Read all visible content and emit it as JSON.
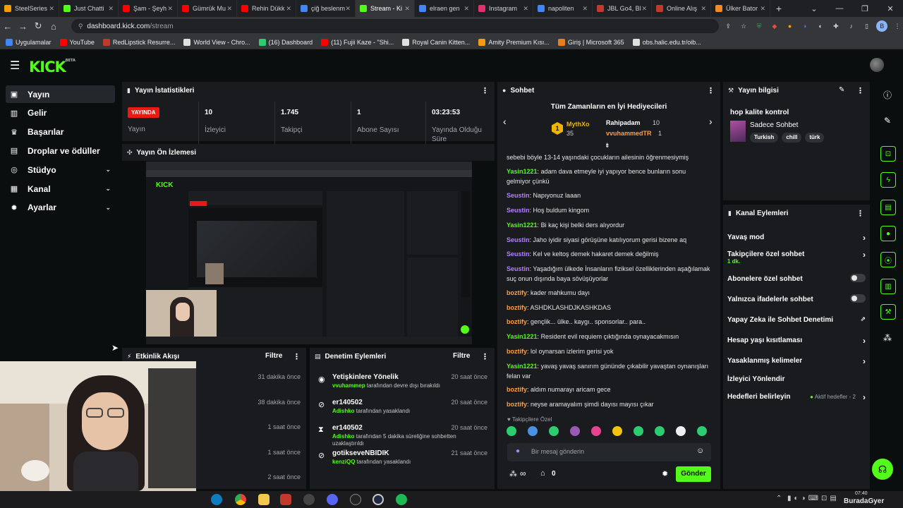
{
  "browser": {
    "tabs": [
      {
        "label": "SteelSeries",
        "color": "#f29f05"
      },
      {
        "label": "Just Chatti",
        "color": "#53fc18"
      },
      {
        "label": "Şam - Şeyh",
        "color": "#ff0000"
      },
      {
        "label": "Gümrük Mu",
        "color": "#ff0000"
      },
      {
        "label": "Rehin Dükk",
        "color": "#ff0000"
      },
      {
        "label": "çiğ beslenm",
        "color": "#4285f4"
      },
      {
        "label": "Stream - Ki",
        "color": "#53fc18",
        "active": true
      },
      {
        "label": "elraen gen",
        "color": "#4285f4"
      },
      {
        "label": "Instagram",
        "color": "#e1306c"
      },
      {
        "label": "napoliten",
        "color": "#4285f4"
      },
      {
        "label": "JBL Go4, Bl",
        "color": "#c0392b"
      },
      {
        "label": "Online Alış",
        "color": "#c0392b"
      },
      {
        "label": "Ülker Bator",
        "color": "#f08a24"
      }
    ],
    "new_tab": "+",
    "window_controls": [
      "⌄",
      "—",
      "❐",
      "✕"
    ],
    "url_host": "dashboard.kick.com",
    "url_path": "/stream",
    "bookmarks": [
      {
        "label": "Uygulamalar",
        "color": "#4285f4"
      },
      {
        "label": "YouTube",
        "color": "#ff0000"
      },
      {
        "label": "RedLipstick Resurre...",
        "color": "#c0392b"
      },
      {
        "label": "World View - Chro...",
        "color": "#e0e0e0"
      },
      {
        "label": "(16) Dashboard",
        "color": "#2ecc71"
      },
      {
        "label": "(11) Fujii Kaze - \"Shi...",
        "color": "#ff0000"
      },
      {
        "label": "Royal Canin Kitten...",
        "color": "#e0e0e0"
      },
      {
        "label": "Amity Premium Kısı...",
        "color": "#f39c12"
      },
      {
        "label": "Giriş | Microsoft 365",
        "color": "#e67e22"
      },
      {
        "label": "obs.halic.edu.tr/oib...",
        "color": "#e0e0e0"
      }
    ]
  },
  "kick": {
    "logo": "KICK",
    "logo_sup": "BETA",
    "sidebar": [
      {
        "label": "Yayın",
        "icon": "video-icon",
        "glyph": "▣",
        "active": true
      },
      {
        "label": "Gelir",
        "icon": "revenue-icon",
        "glyph": "▥"
      },
      {
        "label": "Başarılar",
        "icon": "trophy-icon",
        "glyph": "♛"
      },
      {
        "label": "Droplar ve ödüller",
        "icon": "gift-icon",
        "glyph": "▤"
      },
      {
        "label": "Stüdyo",
        "icon": "studio-icon",
        "glyph": "◎",
        "chevron": true
      },
      {
        "label": "Kanal",
        "icon": "channel-icon",
        "glyph": "▦",
        "chevron": true
      },
      {
        "label": "Ayarlar",
        "icon": "gear-icon",
        "glyph": "✹",
        "chevron": true
      }
    ],
    "stats": {
      "title": "Yayın İstatistikleri",
      "live_badge": "YAYINDA",
      "live_label": "Yayın",
      "items": [
        {
          "value": "10",
          "label": "İzleyici"
        },
        {
          "value": "1.745",
          "label": "Takipçi"
        },
        {
          "value": "1",
          "label": "Abone Sayısı"
        },
        {
          "value": "03:23:53",
          "label": "Yayında Olduğu Süre"
        }
      ]
    },
    "preview": {
      "title": "Yayın Ön İzlemesi"
    },
    "activity": {
      "title": "Etkinlik Akışı",
      "filter": "Filtre",
      "times": [
        "31 dakika önce",
        "38 dakika önce",
        "1 saat önce",
        "1 saat önce",
        "2 saat önce"
      ]
    },
    "moderation": {
      "title": "Denetim Eylemleri",
      "filter": "Filtre",
      "items": [
        {
          "name": "Yetişkinlere Yönelik",
          "time": "20 saat önce",
          "actor": "vvuhammep",
          "text": " tarafından devre dışı bırakıldı",
          "icon": "eye-icon",
          "glyph": "◉"
        },
        {
          "name": "er140502",
          "time": "20 saat önce",
          "actor": "Adishko",
          "text": " tarafından yasaklandı",
          "icon": "ban-icon",
          "glyph": "⊘"
        },
        {
          "name": "er140502",
          "time": "20 saat önce",
          "actor": "Adishko",
          "text": " tarafından 5 dakika süreliğine sohbetten uzaklaştırıldı",
          "icon": "hourglass-icon",
          "glyph": "⧗"
        },
        {
          "name": "gotikseveNBIDIK",
          "time": "21 saat önce",
          "actor": "kenziQQ",
          "text": " tarafından yasaklandı",
          "icon": "ban-icon",
          "glyph": "⊘"
        }
      ]
    },
    "chat": {
      "title": "Sohbet",
      "gifters_title": "Tüm Zamanların en İyi Hediyecileri",
      "gifters": [
        {
          "name": "MythXo",
          "count": "35"
        },
        {
          "name": "Rahipadam",
          "count": "10"
        },
        {
          "name": "vvuhammedTR",
          "count": "1"
        }
      ],
      "messages": [
        {
          "user": "",
          "color": "#e6e6e6",
          "text": "sebebi böyle 13-14 yaşındaki çocukların ailesinin öğrenmesiymiş"
        },
        {
          "user": "Yasin1221",
          "color": "#53fc18",
          "text": "adam dava etmeyle iyi yapıyor bence bunların sonu gelmiyor çünkü"
        },
        {
          "user": "Seustin",
          "color": "#b580ff",
          "text": "Napıyonuz laaan"
        },
        {
          "user": "Seustin",
          "color": "#b580ff",
          "text": "Hoş buldum kingom"
        },
        {
          "user": "Yasin1221",
          "color": "#53fc18",
          "text": "Bi kaç kişi belki ders alıyordur"
        },
        {
          "user": "Seustin",
          "color": "#b580ff",
          "text": "Jaho iyidir siyasi görüşüne katılıyorum gerisi bizene aq"
        },
        {
          "user": "Seustin",
          "color": "#b580ff",
          "text": "Kel ve keltoş demek hakaret demek değilmiş"
        },
        {
          "user": "Seustin",
          "color": "#b580ff",
          "text": "Yaşadığım ülkede İnsanların fiziksel özelliklerinden aşağılamak suç onun dışında baya sövüşüyorlar"
        },
        {
          "user": "boztify",
          "color": "#ff9f43",
          "text": "kader mahkumu dayı"
        },
        {
          "user": "boztify",
          "color": "#ff9f43",
          "text": "ASHDKLASHDJKASHKDAS"
        },
        {
          "user": "boztify",
          "color": "#ff9f43",
          "text": "gençlik... ülke.. kaygı.. sponsorlar.. para.."
        },
        {
          "user": "Yasin1221",
          "color": "#53fc18",
          "text": "Resident evil requiem çıktığında oynayacakmısın"
        },
        {
          "user": "boztify",
          "color": "#ff9f43",
          "text": "lol oynarsan izlerim gerisi yok"
        },
        {
          "user": "Yasin1221",
          "color": "#53fc18",
          "text": "yavaş yavaş sanırım gününde çıkabilir yavaştan oynanışları felan var"
        },
        {
          "user": "boztify",
          "color": "#ff9f43",
          "text": "aldım numarayı aricam gece"
        },
        {
          "user": "boztify",
          "color": "#ff9f43",
          "text": "neyse aramayalım şimdi dayısı mayısı çıkar"
        }
      ],
      "followers_only": "Takipçilere Özel",
      "input_placeholder": "Bir mesaj gönderin",
      "infinity": "∞",
      "gift_count": "0",
      "send": "Gönder"
    },
    "stream_info": {
      "title": "Yayın bilgisi",
      "stream_title": "hop kalite kontrol",
      "category": "Sadece Sohbet",
      "tags": [
        "Turkish",
        "chill",
        "türk"
      ]
    },
    "channel_actions": {
      "title": "Kanal Eylemleri",
      "rows": [
        {
          "label": "Yavaş mod",
          "kind": "arrow"
        },
        {
          "label": "Takipçilere özel sohbet",
          "sub": "1 dk.",
          "kind": "arrow"
        },
        {
          "label": "Abonelere özel sohbet",
          "kind": "toggle"
        },
        {
          "label": "Yalnızca ifadelerle sohbet",
          "kind": "toggle"
        },
        {
          "label": "Yapay Zeka ile Sohbet Denetimi",
          "kind": "external"
        },
        {
          "label": "Hesap yaşı kısıtlaması",
          "kind": "arrow"
        },
        {
          "label": "Yasaklanmış kelimeler",
          "kind": "arrow"
        },
        {
          "label": "İzleyici Yönlendir",
          "kind": "none"
        },
        {
          "label": "Hedefleri belirleyin",
          "kind": "arrow",
          "extra": "Aktif hedefler - 2"
        }
      ]
    }
  },
  "taskbar": {
    "time": "07:40",
    "watermark": "BuradaGyer"
  },
  "colors": {
    "kick_green": "#53fc18",
    "live_red": "#e91916",
    "panel": "#191b1f",
    "page": "#0b0e0f"
  }
}
